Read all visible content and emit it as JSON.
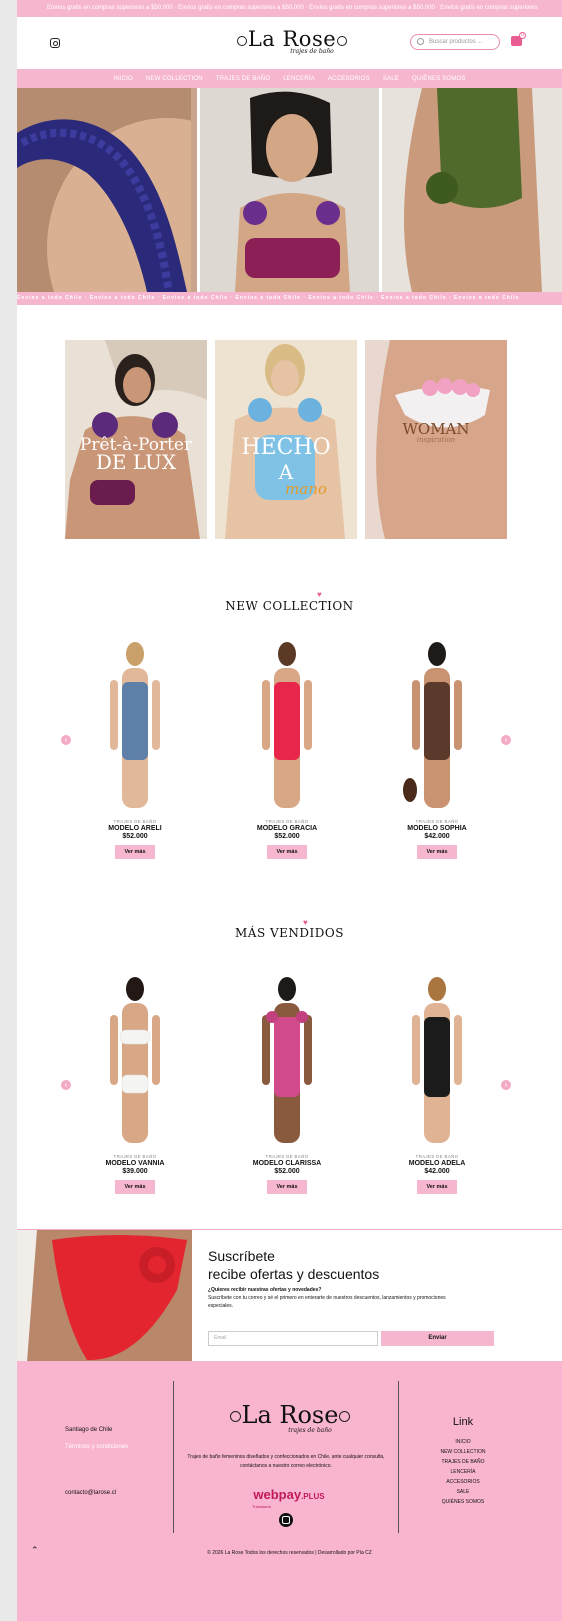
{
  "topbar": {
    "text": "Envíos gratis en compras superiores a $50.000 · Envíos gratis en compras superiores a $50.000 · Envíos gratis en compras superiores a $50.000 · Envíos gratis en compras superiores"
  },
  "header": {
    "logo_name": "La Rose",
    "logo_tagline": "trajes de baño",
    "search_placeholder": "Buscar productos ...",
    "cart_count": "0"
  },
  "nav": [
    "INICIO",
    "NEW COLLECTION",
    "TRAJES DE BAÑO",
    "LENCERÍA",
    "ACCESORIOS",
    "SALE",
    "QUIÉNES SOMOS"
  ],
  "ticker": "Envíos a todo Chile · Envíos a todo Chile · Envíos a todo Chile · Envíos a todo Chile · Envíos a todo Chile · Envíos a todo Chile · Envíos a todo Chile",
  "categories": [
    {
      "line1": "Prêt-à-Porter",
      "line2": "DE LUX"
    },
    {
      "line1": "HECHO",
      "line2": "A",
      "line3": "mano"
    },
    {
      "line1": "WOMAN",
      "line2": "inspiration"
    }
  ],
  "new_collection": {
    "title": "NEW COLLECTION",
    "products": [
      {
        "category": "TRAJES DE BAÑO",
        "name": "MODELO ARELI",
        "price": "$52.000",
        "button": "Ver más",
        "color": "#5d7fa8"
      },
      {
        "category": "TRAJES DE BAÑO",
        "name": "MODELO GRACIA",
        "price": "$52.000",
        "button": "Ver más",
        "color": "#e8264b"
      },
      {
        "category": "TRAJES DE BAÑO",
        "name": "MODELO SOPHIA",
        "price": "$42.000",
        "button": "Ver más",
        "color": "#5b3a2c"
      }
    ]
  },
  "best_sellers": {
    "title": "MÁS VENDIDOS",
    "products": [
      {
        "category": "TRAJES DE BAÑO",
        "name": "MODELO VANNIA",
        "price": "$39.000",
        "button": "Ver más",
        "color": "#f4f4f2"
      },
      {
        "category": "TRAJES DE BAÑO",
        "name": "MODELO CLARISSA",
        "price": "$52.000",
        "button": "Ver más",
        "color": "#d14a8c"
      },
      {
        "category": "TRAJES DE BAÑO",
        "name": "MODELO ADELA",
        "price": "$42.000",
        "button": "Ver más",
        "color": "#1b1b1b"
      }
    ]
  },
  "subscribe": {
    "title1": "Suscríbete",
    "title2": "recibe ofertas y descuentos",
    "question": "¿Quieres recibir nuestras ofertas y novedades?",
    "body": "Suscríbete con tu correo y sé el primero en enterarte de nuestros descuentos, lanzamientos y promociones especiales.",
    "email_placeholder": "Email",
    "send": "Enviar"
  },
  "footer": {
    "location": "Santiago de Chile",
    "terms": "Términos y condiciones",
    "email": "contacto@larose.cl",
    "description": "Trajes de baño femeninos diseñados y confeccionados en Chile, ante cualquier consulta, contáctanos a nuestro correo electrónico.",
    "webpay_main": "webpay",
    "webpay_plus": ".PLUS",
    "webpay_sub": "Transbank.",
    "links_title": "Link",
    "links": [
      "INICIO",
      "NEW COLLECTION",
      "TRAJES DE BAÑO",
      "LENCERÍA",
      "ACCESORIOS",
      "SALE",
      "QUIÉNES SOMOS"
    ],
    "copyright": "© 2026 La Rose Todos los derechos reservados | Desarrollado por Pía CZ"
  },
  "colors": {
    "brand_pink": "#f7b6cf",
    "accent_pink": "#e95d93"
  }
}
